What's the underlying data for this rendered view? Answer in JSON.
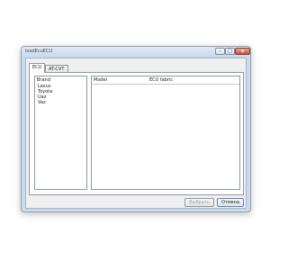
{
  "window": {
    "title": "loadEcuECU",
    "controls": {
      "minimize": "–",
      "maximize": "□",
      "close": "x"
    }
  },
  "tabs": [
    {
      "label": "ECU",
      "selected": true
    },
    {
      "label": "AT-CVT",
      "selected": false
    }
  ],
  "brand_list": {
    "header": "Brand",
    "items": [
      "Lexus",
      "Toyota",
      "Uaz",
      "Vaz"
    ]
  },
  "model_list": {
    "columns": [
      "Model",
      "ECU fabric"
    ]
  },
  "buttons": {
    "select": "Выбрать",
    "cancel": "Отмена"
  }
}
